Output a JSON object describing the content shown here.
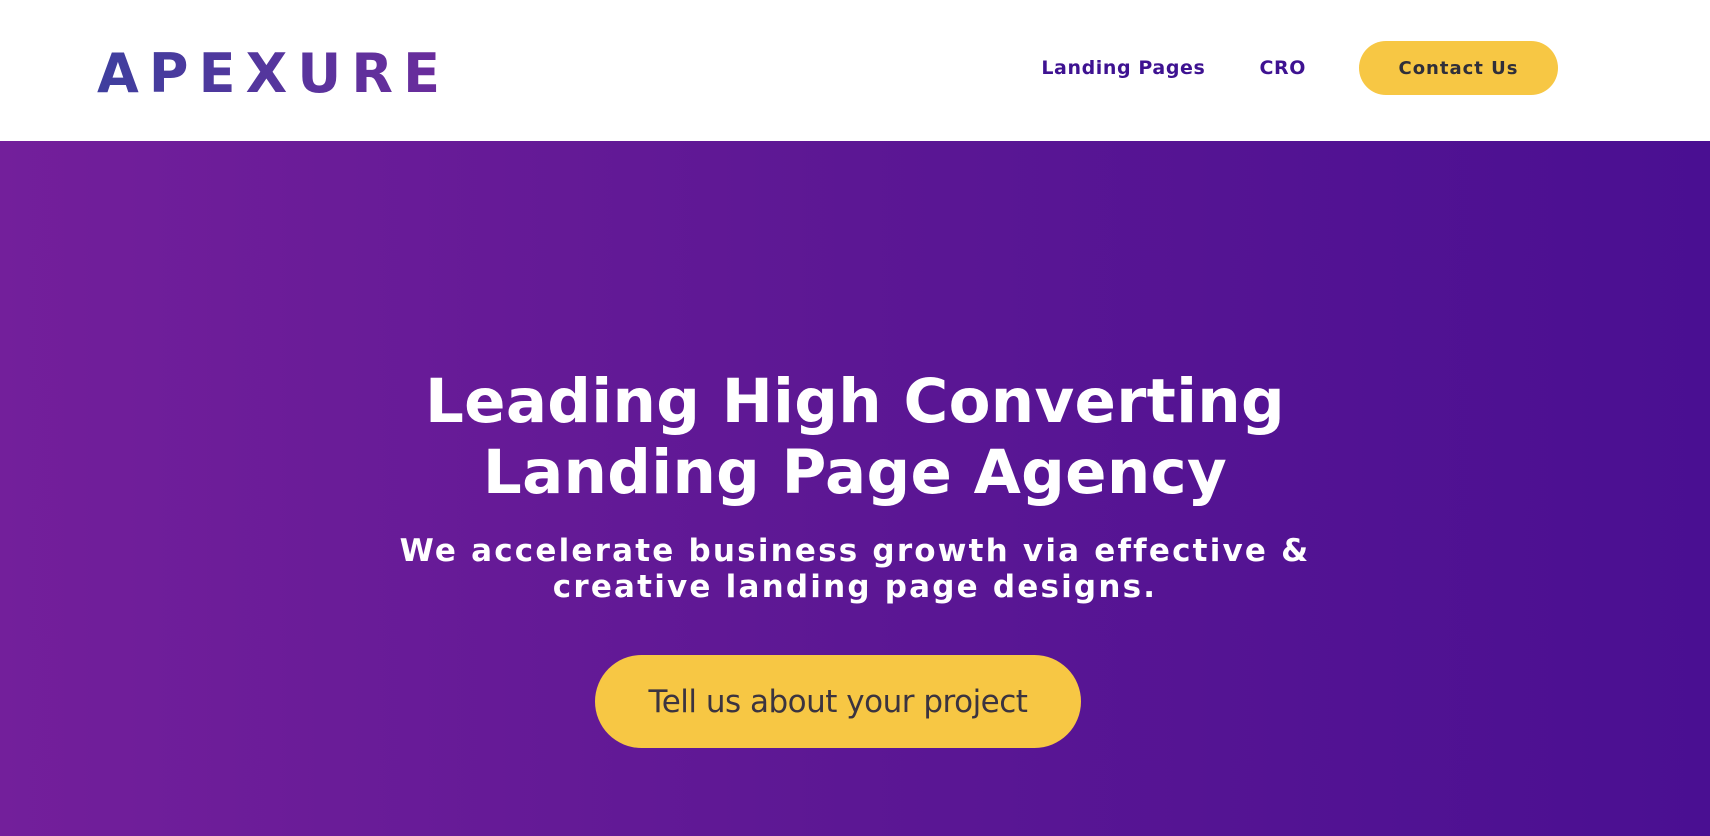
{
  "brand": {
    "logo_text": "APEXURE",
    "logo_gradient_start": "#3f3f9e",
    "logo_gradient_end": "#6a2c9c"
  },
  "nav": {
    "items": [
      {
        "label": "Landing Pages"
      },
      {
        "label": "CRO"
      }
    ],
    "contact_label": "Contact Us"
  },
  "hero": {
    "title_lines": [
      "Leading High Converting",
      "Landing Page Agency"
    ],
    "subtitle_lines": [
      "We accelerate business growth via effective &",
      "creative landing page designs."
    ],
    "cta_label": "Tell us about your project"
  },
  "colors": {
    "nav_text": "#3e1291",
    "accent_yellow": "#f7c744",
    "hero_gradient_start": "#731f9b",
    "hero_gradient_end": "#4a0f92"
  }
}
